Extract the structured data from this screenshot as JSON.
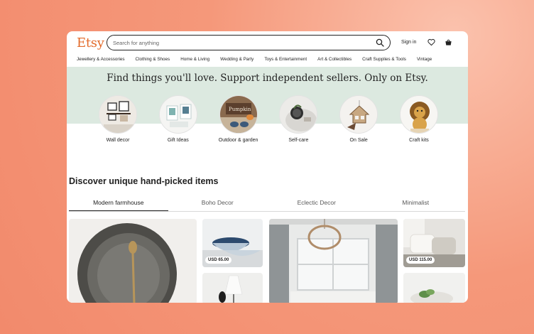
{
  "header": {
    "logo": "Etsy",
    "search_placeholder": "Search for anything",
    "sign_in": "Sign in"
  },
  "categories": [
    "Jewellery & Accessories",
    "Clothing & Shoes",
    "Home & Living",
    "Wedding & Party",
    "Toys & Entertainment",
    "Art & Collectibles",
    "Craft Supplies & Tools",
    "Vintage"
  ],
  "banner": {
    "tagline": "Find things you'll love. Support independent sellers. Only on Etsy.",
    "circles": [
      {
        "label": "Wall decor"
      },
      {
        "label": "Gift Ideas"
      },
      {
        "label": "Outdoor & garden"
      },
      {
        "label": "Self-care"
      },
      {
        "label": "On Sale"
      },
      {
        "label": "Craft kits"
      }
    ]
  },
  "discover": {
    "title": "Discover unique hand-picked items",
    "tabs": [
      "Modern farmhouse",
      "Boho Decor",
      "Eclectic Decor",
      "Minimalist"
    ],
    "active_tab": "Modern farmhouse"
  },
  "products": [
    {
      "price": ""
    },
    {
      "price": "USD 65.00"
    },
    {
      "price": ""
    },
    {
      "price": ""
    },
    {
      "price": "USD 115.00"
    },
    {
      "price": ""
    }
  ],
  "colors": {
    "brand": "#e36b2b",
    "banner_bg": "#dce9e0",
    "background": "#f5987a"
  }
}
